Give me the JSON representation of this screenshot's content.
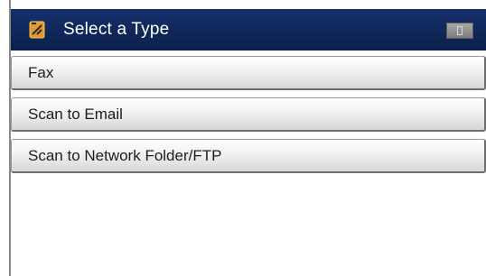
{
  "header": {
    "icon": "scan-icon",
    "title": "Select a Type",
    "status_icon": "status-indicator-icon"
  },
  "menu": {
    "items": [
      {
        "label": "Fax"
      },
      {
        "label": "Scan to Email"
      },
      {
        "label": "Scan to Network Folder/FTP"
      }
    ]
  },
  "colors": {
    "header_bg": "#0f2759",
    "button_bg": "#f1f1f1",
    "text": "#1d1d1d"
  }
}
